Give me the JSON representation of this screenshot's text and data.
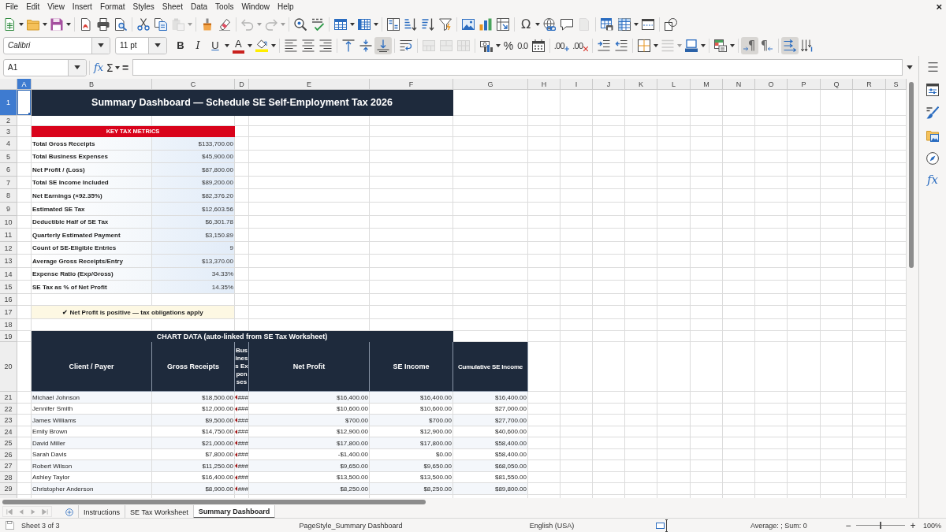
{
  "menu_bar": {
    "items": [
      "File",
      "Edit",
      "View",
      "Insert",
      "Format",
      "Styles",
      "Sheet",
      "Data",
      "Tools",
      "Window",
      "Help"
    ],
    "close": "×"
  },
  "standard_toolbar": {
    "paste": {
      "disabled": true
    },
    "undo": {
      "disabled": true
    },
    "redo": {
      "disabled": true
    },
    "special_character": "Ω",
    "header_footer": {
      "disabled": true
    }
  },
  "formatting_toolbar": {
    "font_name": "Calibri",
    "font_size": "11 pt",
    "bold": "B",
    "italic": "I",
    "underline": "U",
    "font_color": "A",
    "horizontal_align": [
      {
        "selected": false
      },
      {
        "selected": false
      },
      {
        "selected": false
      }
    ],
    "vertical_align": [
      {
        "selected": false
      },
      {
        "selected": false
      },
      {
        "selected": true
      }
    ],
    "merge_buttons": [
      {
        "disabled": true
      },
      {
        "disabled": true
      },
      {
        "disabled": true
      }
    ],
    "percent": "%",
    "standard_format": "0.0",
    "add_decimal": ".00",
    "delete_decimal": ".00",
    "border_style": {
      "disabled": true
    },
    "paragraph_direction": [
      {
        "glyph": "¶",
        "selected": true
      },
      {
        "glyph": "¶",
        "selected": false
      }
    ],
    "text_direction": [
      {
        "selected": true
      },
      {
        "selected": false
      }
    ]
  },
  "formula_bar": {
    "name_box": "A1",
    "function_wizard": "fx",
    "sum": "Σ",
    "equals": "="
  },
  "columns": [
    {
      "label": "A",
      "selected": true
    },
    {
      "label": "B",
      "selected": false
    },
    {
      "label": "C",
      "selected": false
    },
    {
      "label": "D",
      "selected": false
    },
    {
      "label": "E",
      "selected": false
    },
    {
      "label": "F",
      "selected": false
    },
    {
      "label": "G",
      "selected": false
    },
    {
      "label": "H",
      "selected": false
    },
    {
      "label": "I",
      "selected": false
    },
    {
      "label": "J",
      "selected": false
    },
    {
      "label": "K",
      "selected": false
    },
    {
      "label": "L",
      "selected": false
    },
    {
      "label": "M",
      "selected": false
    },
    {
      "label": "N",
      "selected": false
    },
    {
      "label": "O",
      "selected": false
    },
    {
      "label": "P",
      "selected": false
    },
    {
      "label": "Q",
      "selected": false
    },
    {
      "label": "R",
      "selected": false
    },
    {
      "label": "S",
      "selected": false
    }
  ],
  "rows": [
    {
      "label": "1",
      "selected": true
    },
    {
      "label": "2",
      "selected": false
    },
    {
      "label": "3",
      "selected": false
    },
    {
      "label": "4",
      "selected": false
    },
    {
      "label": "5",
      "selected": false
    },
    {
      "label": "6",
      "selected": false
    },
    {
      "label": "7",
      "selected": false
    },
    {
      "label": "8",
      "selected": false
    },
    {
      "label": "9",
      "selected": false
    },
    {
      "label": "10",
      "selected": false
    },
    {
      "label": "11",
      "selected": false
    },
    {
      "label": "12",
      "selected": false
    },
    {
      "label": "13",
      "selected": false
    },
    {
      "label": "14",
      "selected": false
    },
    {
      "label": "15",
      "selected": false
    },
    {
      "label": "16",
      "selected": false
    },
    {
      "label": "17",
      "selected": false
    },
    {
      "label": "18",
      "selected": false
    },
    {
      "label": "19",
      "selected": false
    },
    {
      "label": "20",
      "selected": false
    },
    {
      "label": "21",
      "selected": false
    },
    {
      "label": "22",
      "selected": false
    },
    {
      "label": "23",
      "selected": false
    },
    {
      "label": "24",
      "selected": false
    },
    {
      "label": "25",
      "selected": false
    },
    {
      "label": "26",
      "selected": false
    },
    {
      "label": "27",
      "selected": false
    },
    {
      "label": "28",
      "selected": false
    },
    {
      "label": "29",
      "selected": false
    }
  ],
  "sheet": {
    "title": "Summary Dashboard — Schedule SE Self-Employment Tax 2026",
    "metrics_heading": "KEY TAX METRICS",
    "metrics": [
      {
        "label": "Total Gross Receipts",
        "value": "$133,700.00"
      },
      {
        "label": "Total Business Expenses",
        "value": "$45,900.00"
      },
      {
        "label": "Net Profit / (Loss)",
        "value": "$87,800.00"
      },
      {
        "label": "Total SE Income Included",
        "value": "$89,200.00"
      },
      {
        "label": "Net Earnings (×92.35%)",
        "value": "$82,376.20"
      },
      {
        "label": "Estimated SE Tax",
        "value": "$12,603.56"
      },
      {
        "label": "Deductible Half of SE Tax",
        "value": "$6,301.78"
      },
      {
        "label": "Quarterly Estimated Payment",
        "value": "$3,150.89"
      },
      {
        "label": "Count of SE-Eligible Entries",
        "value": "9"
      },
      {
        "label": "Average Gross Receipts/Entry",
        "value": "$13,370.00"
      },
      {
        "label": "Expense Ratio (Exp/Gross)",
        "value": "34.33%"
      },
      {
        "label": "SE Tax as % of Net Profit",
        "value": "14.35%"
      }
    ],
    "status_note": "✔ Net Profit is positive — tax obligations apply",
    "chart_data_heading": "CHART DATA (auto-linked from SE Tax Worksheet)",
    "table_columns": [
      "Client / Payer",
      "Gross Receipts",
      "Business Expenses",
      "Net Profit",
      "SE Income",
      "Cumulative SE Income"
    ],
    "table_rows": [
      {
        "client": "Michael Johnson",
        "gross_receipts": "$18,500.00",
        "business_expenses": "###",
        "clipped": true,
        "net_profit": "$16,400.00",
        "se_income": "$16,400.00",
        "cumulative_se_income": "$16,400.00"
      },
      {
        "client": "Jennifer Smith",
        "gross_receipts": "$12,000.00",
        "business_expenses": "###",
        "clipped": true,
        "net_profit": "$10,600.00",
        "se_income": "$10,600.00",
        "cumulative_se_income": "$27,000.00"
      },
      {
        "client": "James Williams",
        "gross_receipts": "$9,500.00",
        "business_expenses": "###",
        "clipped": true,
        "net_profit": "$700.00",
        "se_income": "$700.00",
        "cumulative_se_income": "$27,700.00"
      },
      {
        "client": "Emily Brown",
        "gross_receipts": "$14,750.00",
        "business_expenses": "###",
        "clipped": true,
        "net_profit": "$12,900.00",
        "se_income": "$12,900.00",
        "cumulative_se_income": "$40,600.00"
      },
      {
        "client": "David Miller",
        "gross_receipts": "$21,000.00",
        "business_expenses": "###",
        "clipped": true,
        "net_profit": "$17,800.00",
        "se_income": "$17,800.00",
        "cumulative_se_income": "$58,400.00"
      },
      {
        "client": "Sarah Davis",
        "gross_receipts": "$7,800.00",
        "business_expenses": "###",
        "clipped": true,
        "net_profit": "-$1,400.00",
        "se_income": "$0.00",
        "cumulative_se_income": "$58,400.00"
      },
      {
        "client": "Robert Wilson",
        "gross_receipts": "$11,250.00",
        "business_expenses": "###",
        "clipped": true,
        "net_profit": "$9,650.00",
        "se_income": "$9,650.00",
        "cumulative_se_income": "$68,050.00"
      },
      {
        "client": "Ashley Taylor",
        "gross_receipts": "$16,400.00",
        "business_expenses": "###",
        "clipped": true,
        "net_profit": "$13,500.00",
        "se_income": "$13,500.00",
        "cumulative_se_income": "$81,550.00"
      },
      {
        "client": "Christopher Anderson",
        "gross_receipts": "$8,900.00",
        "business_expenses": "###",
        "clipped": true,
        "net_profit": "$8,250.00",
        "se_income": "$8,250.00",
        "cumulative_se_income": "$89,800.00"
      }
    ]
  },
  "sheet_tabs": {
    "navigation": {
      "disabled": true
    },
    "tabs": [
      {
        "label": "Instructions",
        "selected": false
      },
      {
        "label": "SE Tax Worksheet",
        "selected": false
      },
      {
        "label": "Summary Dashboard",
        "selected": true
      }
    ]
  },
  "sidebar": {
    "functions": "fx"
  },
  "status_bar": {
    "sheet": "Sheet 3 of 3",
    "page_style": "PageStyle_Summary Dashboard",
    "language": "English (USA)",
    "selection_summary": "Average: ; Sum: 0",
    "zoom_out": "−",
    "zoom_slider": {
      "level": 0.5
    },
    "zoom_in": "+",
    "zoom": "100%"
  }
}
